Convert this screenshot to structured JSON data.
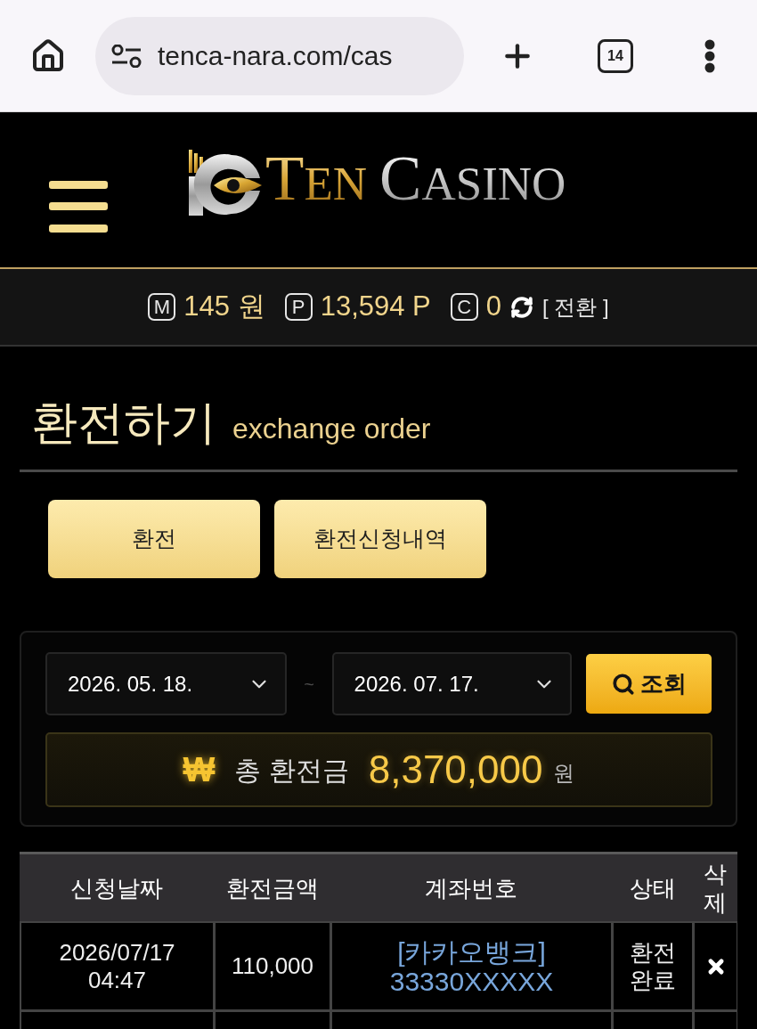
{
  "browser": {
    "url": "tenca-nara.com/cas",
    "tab_count": "14"
  },
  "header": {
    "logo": {
      "word_1": "TEN",
      "word_2": "CASINO"
    }
  },
  "balances": {
    "items": [
      {
        "badge": "M",
        "value": "145 원"
      },
      {
        "badge": "P",
        "value": "13,594 P"
      },
      {
        "badge": "C",
        "value": "0"
      }
    ],
    "convert": "[ 전환 ]"
  },
  "page_title": {
    "title": "환전하기",
    "subtitle": "exchange order"
  },
  "tabs": [
    {
      "label": "환전"
    },
    {
      "label": "환전신청내역"
    }
  ],
  "filter": {
    "date_from": "2026. 05. 18.",
    "separator": "~",
    "date_to": "2026. 07. 17.",
    "search_button": "조회"
  },
  "total": {
    "symbol": "₩",
    "label": "총 환전금",
    "amount": "8,370,000",
    "unit": "원"
  },
  "table": {
    "columns": [
      "신청날짜",
      "환전금액",
      "계좌번호",
      "상태",
      "삭제"
    ],
    "rows": [
      {
        "date": "2026/07/17",
        "time": "04:47",
        "amount": "110,000",
        "bank": "[카카오뱅크]",
        "account": "33330XXXXX",
        "status": "환전 완료"
      }
    ]
  }
}
